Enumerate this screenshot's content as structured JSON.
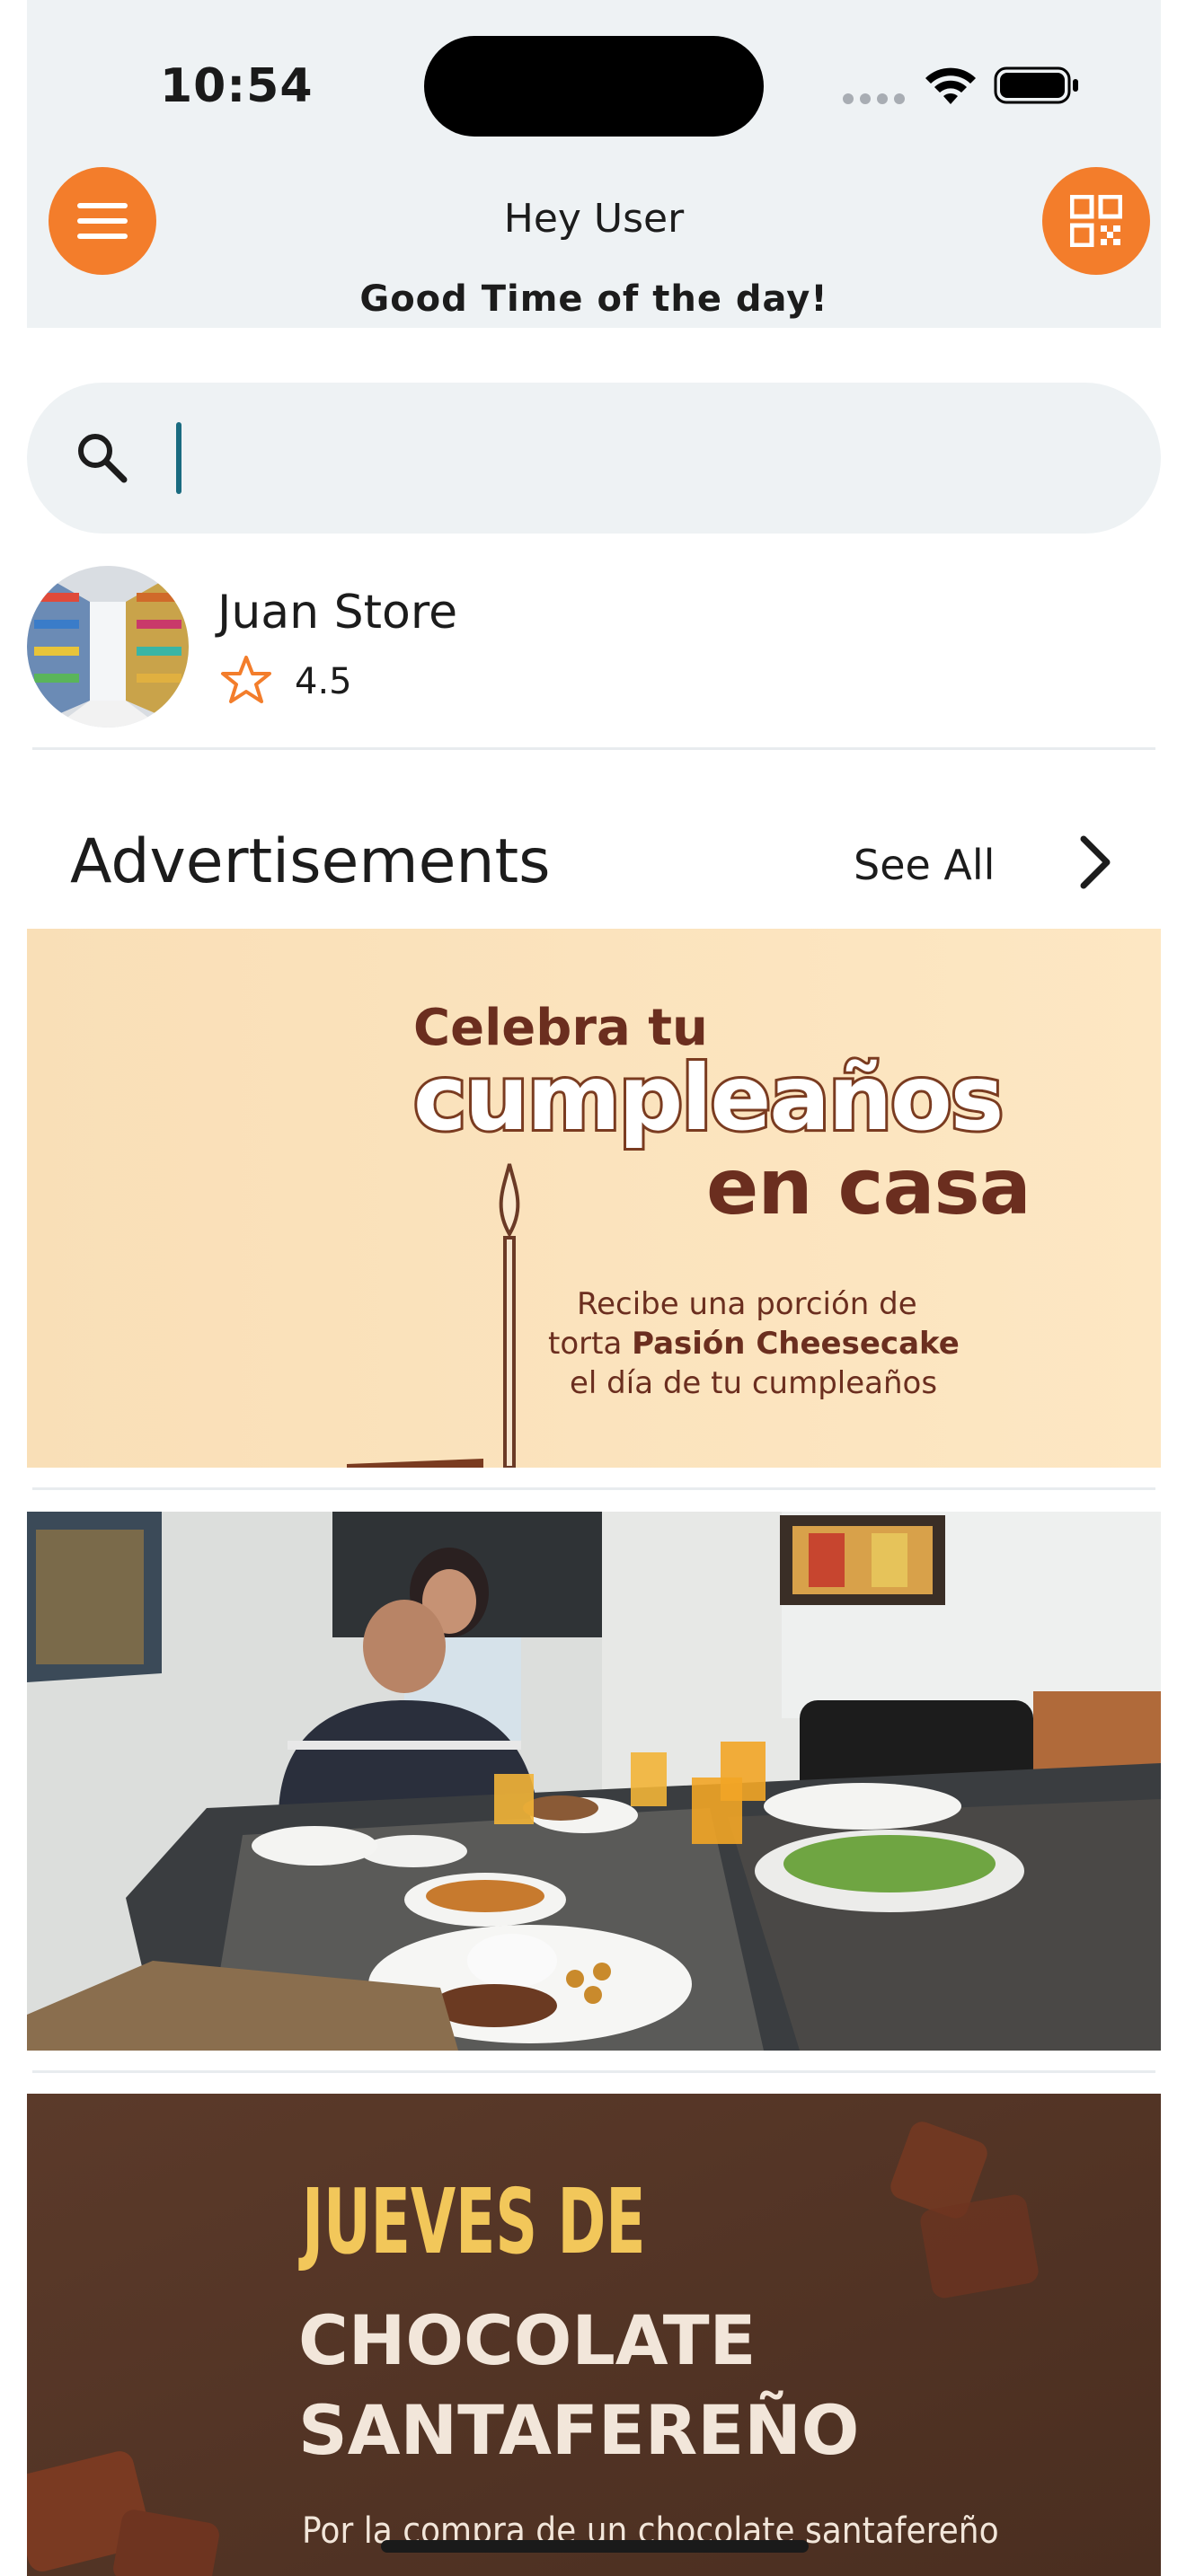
{
  "status_bar": {
    "time": "10:54"
  },
  "header": {
    "greeting": "Hey User",
    "subgreeting": "Good Time of the day!",
    "menu_icon": "hamburger-menu-icon",
    "qr_icon": "qr-code-icon",
    "accent_color": "#f37d2b"
  },
  "search": {
    "value": "",
    "placeholder": ""
  },
  "store": {
    "name": "Juan Store",
    "rating": "4.5"
  },
  "ads": {
    "title": "Advertisements",
    "see_all_label": "See All",
    "items": [
      {
        "line1": "Celebra tu",
        "line2": "cumpleaños",
        "line3": "en casa",
        "body1": "Recibe una porción de",
        "body2a": "torta ",
        "body2b": "Pasión Cheesecake",
        "body3": "el día de tu cumpleaños"
      },
      {
        "kind": "photo"
      },
      {
        "line1": "JUEVES DE",
        "line2": "CHOCOLATE",
        "line3": "SANTAFEREÑO",
        "body1": "Por la compra de un chocolate santafereño"
      }
    ]
  }
}
